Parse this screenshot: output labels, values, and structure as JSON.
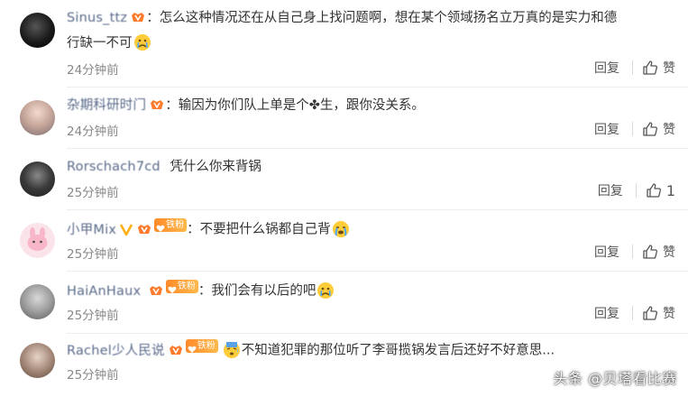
{
  "colors": {
    "username": "#596a8a",
    "text": "#333333",
    "time": "#888888",
    "divider": "#eeeeee",
    "fan_badge": "#ff9a30"
  },
  "actions": {
    "reply_label": "回复",
    "like_label": "赞"
  },
  "comments": [
    {
      "username": "Sinus_ttz",
      "text": "：怎么这种情况还在从自己身上找问题啊，想在某个领域扬名立万真的是实力和德",
      "text_line2": "行缺一不可",
      "time": "24分钟前",
      "like_count": "",
      "emoji": "crying-emoji"
    },
    {
      "username": "杂期科研时门",
      "text": "：输因为你们队上单是个✤生，跟你没关系。",
      "time": "24分钟前",
      "like_count": ""
    },
    {
      "username": "Rorschach7cd",
      "text": "凭什么你来背锅",
      "time": "25分钟前",
      "like_count": "1"
    },
    {
      "username": "小甲Mix",
      "fan_badge": "铁粉",
      "text": "：不要把什么锅都自己背",
      "time": "25分钟前",
      "like_count": "",
      "emoji": "sobbing-emoji"
    },
    {
      "username": "HaiAnHaux",
      "fan_badge": "铁粉",
      "text": "：我们会有以后的吧",
      "time": "25分钟前",
      "like_count": "",
      "emoji": "crying-emoji"
    },
    {
      "username": "Rachel少人民说",
      "fan_badge": "铁粉",
      "text": "不知道犯罪的那位听了李哥揽锅发言后还好不好意思...",
      "time": "25分钟前",
      "like_count": "",
      "emoji": "cold-sweat-emoji"
    }
  ],
  "watermark": "头条 @贝塔看比赛"
}
